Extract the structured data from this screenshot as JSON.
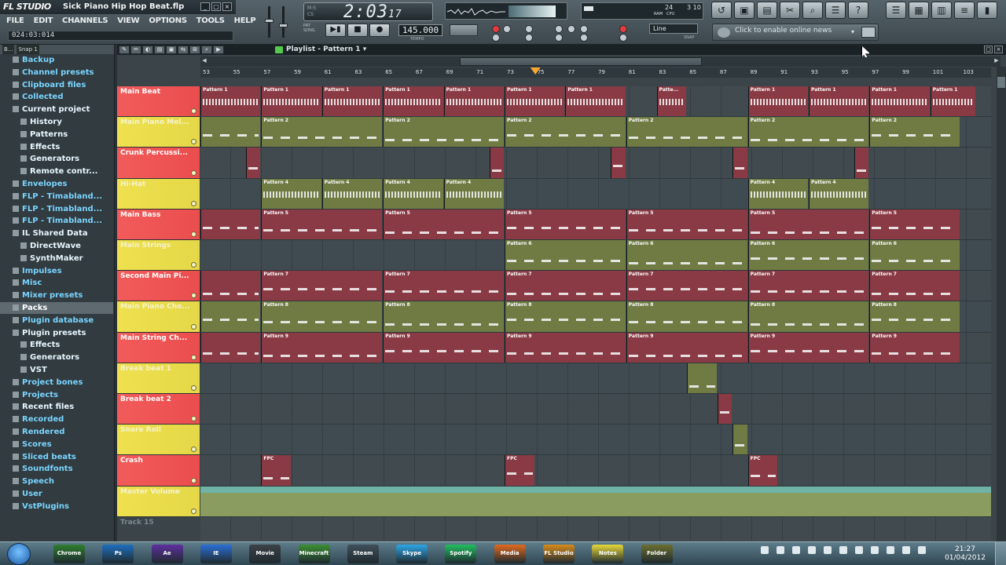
{
  "app": {
    "logo": "FL STUDIO",
    "file_title": "Sick Piano Hip Hop Beat.flp",
    "win_minimize": "_",
    "win_restore": "▢",
    "win_close": "×"
  },
  "menu": [
    "FILE",
    "EDIT",
    "CHANNELS",
    "VIEW",
    "OPTIONS",
    "TOOLS",
    "HELP"
  ],
  "hint_bar": "024:03:014",
  "time_display": {
    "mode_top": "M:S",
    "mode_bottom": "CS",
    "main": "2:03",
    "sub": "17"
  },
  "transport": {
    "pat_label": "PAT",
    "song_label": "SONG",
    "play_icon": "▶▮",
    "stop_icon": "■",
    "record_icon": "●",
    "tempo": "145.000",
    "tempo_label": "TEMPO"
  },
  "cpu": {
    "ram": "24",
    "poly": "3 10",
    "label_ram": "RAM",
    "label_cpu": "CPU"
  },
  "snap": {
    "value": "Line",
    "label": "SNAP"
  },
  "news": {
    "text": "Click to enable online news",
    "dropdown": "▾"
  },
  "tool_icons": [
    "↺",
    "▣",
    "▤",
    "✂",
    "⌕",
    "☰",
    "?"
  ],
  "win_icons": [
    "☰",
    "▦",
    "▥",
    "≡",
    "▮"
  ],
  "browser": {
    "header": [
      "B...",
      "Snap 1"
    ],
    "items": [
      {
        "label": "Backup",
        "level": 0,
        "style": "top"
      },
      {
        "label": "Channel presets",
        "level": 0,
        "style": "top"
      },
      {
        "label": "Clipboard files",
        "level": 0,
        "style": "top"
      },
      {
        "label": "Collected",
        "level": 0,
        "style": "top"
      },
      {
        "label": "Current project",
        "level": 0,
        "style": "open"
      },
      {
        "label": "History",
        "level": 1,
        "style": "bold"
      },
      {
        "label": "Patterns",
        "level": 1,
        "style": "bold"
      },
      {
        "label": "Effects",
        "level": 1,
        "style": "bold"
      },
      {
        "label": "Generators",
        "level": 1,
        "style": "bold"
      },
      {
        "label": "Remote contr...",
        "level": 1,
        "style": "bold"
      },
      {
        "label": "Envelopes",
        "level": 0,
        "style": "top"
      },
      {
        "label": "FLP - Timabland...",
        "level": 0,
        "style": "top"
      },
      {
        "label": "FLP - Timabland...",
        "level": 0,
        "style": "top"
      },
      {
        "label": "FLP - Timabland...",
        "level": 0,
        "style": "top"
      },
      {
        "label": "IL Shared Data",
        "level": 0,
        "style": "open"
      },
      {
        "label": "DirectWave",
        "level": 1,
        "style": "bold"
      },
      {
        "label": "SynthMaker",
        "level": 1,
        "style": "bold"
      },
      {
        "label": "Impulses",
        "level": 0,
        "style": "top"
      },
      {
        "label": "Misc",
        "level": 0,
        "style": "top"
      },
      {
        "label": "Mixer presets",
        "level": 0,
        "style": "top"
      },
      {
        "label": "Packs",
        "level": 0,
        "style": "sel"
      },
      {
        "label": "Plugin database",
        "level": 0,
        "style": "top"
      },
      {
        "label": "Plugin presets",
        "level": 0,
        "style": "open"
      },
      {
        "label": "Effects",
        "level": 1,
        "style": "bold"
      },
      {
        "label": "Generators",
        "level": 1,
        "style": "bold"
      },
      {
        "label": "VST",
        "level": 1,
        "style": "bold"
      },
      {
        "label": "Project bones",
        "level": 0,
        "style": "top"
      },
      {
        "label": "Projects",
        "level": 0,
        "style": "top"
      },
      {
        "label": "Recent files",
        "level": 0,
        "style": "open"
      },
      {
        "label": "Recorded",
        "level": 0,
        "style": "top"
      },
      {
        "label": "Rendered",
        "level": 0,
        "style": "top"
      },
      {
        "label": "Scores",
        "level": 0,
        "style": "top"
      },
      {
        "label": "Sliced beats",
        "level": 0,
        "style": "top"
      },
      {
        "label": "Soundfonts",
        "level": 0,
        "style": "top"
      },
      {
        "label": "Speech",
        "level": 0,
        "style": "top"
      },
      {
        "label": "User",
        "level": 0,
        "style": "top"
      },
      {
        "label": "VstPlugins",
        "level": 0,
        "style": "top"
      }
    ]
  },
  "playlist": {
    "title": "Playlist - Pattern 1",
    "dropdown": "▾",
    "tools": [
      "✎",
      "✏",
      "◐",
      "▤",
      "▣",
      "⇆",
      "⊞",
      "⌕",
      "▶"
    ],
    "ruler": [
      "53",
      "55",
      "57",
      "59",
      "61",
      "63",
      "65",
      "67",
      "69",
      "71",
      "73",
      "75",
      "77",
      "79",
      "81",
      "83",
      "85",
      "87",
      "89",
      "91",
      "93",
      "95",
      "97",
      "99",
      "101",
      "103"
    ],
    "playhead_bar": 75,
    "tracks": [
      {
        "name": "Main Beat",
        "color": "red"
      },
      {
        "name": "Main Piano Mel...",
        "color": "yellow"
      },
      {
        "name": "Crunk Percussi...",
        "color": "red"
      },
      {
        "name": "Hi-Hat",
        "color": "yellow"
      },
      {
        "name": "Main Bass",
        "color": "red"
      },
      {
        "name": "Main Strings",
        "color": "yellow"
      },
      {
        "name": "Second Main Pi...",
        "color": "red"
      },
      {
        "name": "Main Piano Cho...",
        "color": "yellow"
      },
      {
        "name": "Main String Ch...",
        "color": "red"
      },
      {
        "name": "Break beat 1",
        "color": "yellow"
      },
      {
        "name": "Break beat 2",
        "color": "red"
      },
      {
        "name": "Snare Roll",
        "color": "yellow"
      },
      {
        "name": "Crash",
        "color": "red"
      },
      {
        "name": "Master Volume",
        "color": "yellow"
      },
      {
        "name": "Track 15",
        "color": "grey"
      }
    ],
    "clips": [
      {
        "track": 0,
        "start": 53,
        "len": 4,
        "label": "Pattern 1"
      },
      {
        "track": 0,
        "start": 57,
        "len": 4,
        "label": "Pattern 1"
      },
      {
        "track": 0,
        "start": 61,
        "len": 4,
        "label": "Pattern 1"
      },
      {
        "track": 0,
        "start": 65,
        "len": 4,
        "label": "Pattern 1"
      },
      {
        "track": 0,
        "start": 69,
        "len": 4,
        "label": "Pattern 1"
      },
      {
        "track": 0,
        "start": 73,
        "len": 4,
        "label": "Pattern 1"
      },
      {
        "track": 0,
        "start": 77,
        "len": 4,
        "label": "Pattern 1"
      },
      {
        "track": 0,
        "start": 83,
        "len": 2,
        "label": "Patte..."
      },
      {
        "track": 0,
        "start": 89,
        "len": 4,
        "label": "Pattern 1"
      },
      {
        "track": 0,
        "start": 93,
        "len": 4,
        "label": "Pattern 1"
      },
      {
        "track": 0,
        "start": 97,
        "len": 4,
        "label": "Pattern 1"
      },
      {
        "track": 0,
        "start": 101,
        "len": 3,
        "label": "Pattern 1"
      },
      {
        "track": 1,
        "start": 53,
        "len": 4,
        "label": ""
      },
      {
        "track": 1,
        "start": 57,
        "len": 8,
        "label": "Pattern 2"
      },
      {
        "track": 1,
        "start": 65,
        "len": 8,
        "label": "Pattern 2"
      },
      {
        "track": 1,
        "start": 73,
        "len": 8,
        "label": "Pattern 2"
      },
      {
        "track": 1,
        "start": 81,
        "len": 8,
        "label": "Pattern 2"
      },
      {
        "track": 1,
        "start": 89,
        "len": 8,
        "label": "Pattern 2"
      },
      {
        "track": 1,
        "start": 97,
        "len": 6,
        "label": "Pattern 2"
      },
      {
        "track": 2,
        "start": 56,
        "len": 1,
        "label": ""
      },
      {
        "track": 2,
        "start": 72,
        "len": 1,
        "label": ""
      },
      {
        "track": 2,
        "start": 80,
        "len": 1,
        "label": ""
      },
      {
        "track": 2,
        "start": 88,
        "len": 1,
        "label": ""
      },
      {
        "track": 2,
        "start": 96,
        "len": 1,
        "label": ""
      },
      {
        "track": 3,
        "start": 57,
        "len": 4,
        "label": "Pattern 4"
      },
      {
        "track": 3,
        "start": 61,
        "len": 4,
        "label": "Pattern 4"
      },
      {
        "track": 3,
        "start": 65,
        "len": 4,
        "label": "Pattern 4"
      },
      {
        "track": 3,
        "start": 69,
        "len": 4,
        "label": "Pattern 4"
      },
      {
        "track": 3,
        "start": 89,
        "len": 4,
        "label": "Pattern 4"
      },
      {
        "track": 3,
        "start": 93,
        "len": 4,
        "label": "Pattern 4"
      },
      {
        "track": 4,
        "start": 53,
        "len": 4,
        "label": ""
      },
      {
        "track": 4,
        "start": 57,
        "len": 8,
        "label": "Pattern 5"
      },
      {
        "track": 4,
        "start": 65,
        "len": 8,
        "label": "Pattern 5"
      },
      {
        "track": 4,
        "start": 73,
        "len": 8,
        "label": "Pattern 5"
      },
      {
        "track": 4,
        "start": 81,
        "len": 8,
        "label": "Pattern 5"
      },
      {
        "track": 4,
        "start": 89,
        "len": 8,
        "label": "Pattern 5"
      },
      {
        "track": 4,
        "start": 97,
        "len": 6,
        "label": "Pattern 5"
      },
      {
        "track": 5,
        "start": 73,
        "len": 8,
        "label": "Pattern 6"
      },
      {
        "track": 5,
        "start": 81,
        "len": 8,
        "label": "Pattern 6"
      },
      {
        "track": 5,
        "start": 89,
        "len": 8,
        "label": "Pattern 6"
      },
      {
        "track": 5,
        "start": 97,
        "len": 6,
        "label": "Pattern 6"
      },
      {
        "track": 6,
        "start": 53,
        "len": 4,
        "label": ""
      },
      {
        "track": 6,
        "start": 57,
        "len": 8,
        "label": "Pattern 7"
      },
      {
        "track": 6,
        "start": 65,
        "len": 8,
        "label": "Pattern 7"
      },
      {
        "track": 6,
        "start": 73,
        "len": 8,
        "label": "Pattern 7"
      },
      {
        "track": 6,
        "start": 81,
        "len": 8,
        "label": "Pattern 7"
      },
      {
        "track": 6,
        "start": 89,
        "len": 8,
        "label": "Pattern 7"
      },
      {
        "track": 6,
        "start": 97,
        "len": 6,
        "label": "Pattern 7"
      },
      {
        "track": 7,
        "start": 53,
        "len": 4,
        "label": ""
      },
      {
        "track": 7,
        "start": 57,
        "len": 8,
        "label": "Pattern 8"
      },
      {
        "track": 7,
        "start": 65,
        "len": 8,
        "label": "Pattern 8"
      },
      {
        "track": 7,
        "start": 73,
        "len": 8,
        "label": "Pattern 8"
      },
      {
        "track": 7,
        "start": 81,
        "len": 8,
        "label": "Pattern 8"
      },
      {
        "track": 7,
        "start": 89,
        "len": 8,
        "label": "Pattern 8"
      },
      {
        "track": 7,
        "start": 97,
        "len": 6,
        "label": "Pattern 8"
      },
      {
        "track": 8,
        "start": 53,
        "len": 4,
        "label": ""
      },
      {
        "track": 8,
        "start": 57,
        "len": 8,
        "label": "Pattern 9"
      },
      {
        "track": 8,
        "start": 65,
        "len": 8,
        "label": "Pattern 9"
      },
      {
        "track": 8,
        "start": 73,
        "len": 8,
        "label": "Pattern 9"
      },
      {
        "track": 8,
        "start": 81,
        "len": 8,
        "label": "Pattern 9"
      },
      {
        "track": 8,
        "start": 89,
        "len": 8,
        "label": "Pattern 9"
      },
      {
        "track": 8,
        "start": 97,
        "len": 6,
        "label": "Pattern 9"
      },
      {
        "track": 9,
        "start": 85,
        "len": 2,
        "label": ""
      },
      {
        "track": 10,
        "start": 87,
        "len": 1,
        "label": ""
      },
      {
        "track": 11,
        "start": 88,
        "len": 1,
        "label": ""
      },
      {
        "track": 12,
        "start": 57,
        "len": 2,
        "label": "FPC"
      },
      {
        "track": 12,
        "start": 73,
        "len": 2,
        "label": "FPC"
      },
      {
        "track": 12,
        "start": 89,
        "len": 2,
        "label": "FPC"
      }
    ]
  },
  "taskbar": {
    "apps": [
      "Chrome",
      "Ps",
      "Ae",
      "IE",
      "Movie",
      "Minecraft",
      "Steam",
      "Skype",
      "Spotify",
      "Media",
      "FL Studio",
      "Notes",
      "Folder"
    ],
    "clock_time": "21:27",
    "clock_date": "01/04/2012"
  },
  "colors": {
    "track_red": "#eb4d4d",
    "track_yellow": "#e5d848",
    "clip_red": "#8a3a44",
    "clip_olive": "#6f7b43",
    "playhead": "#f8a631"
  }
}
